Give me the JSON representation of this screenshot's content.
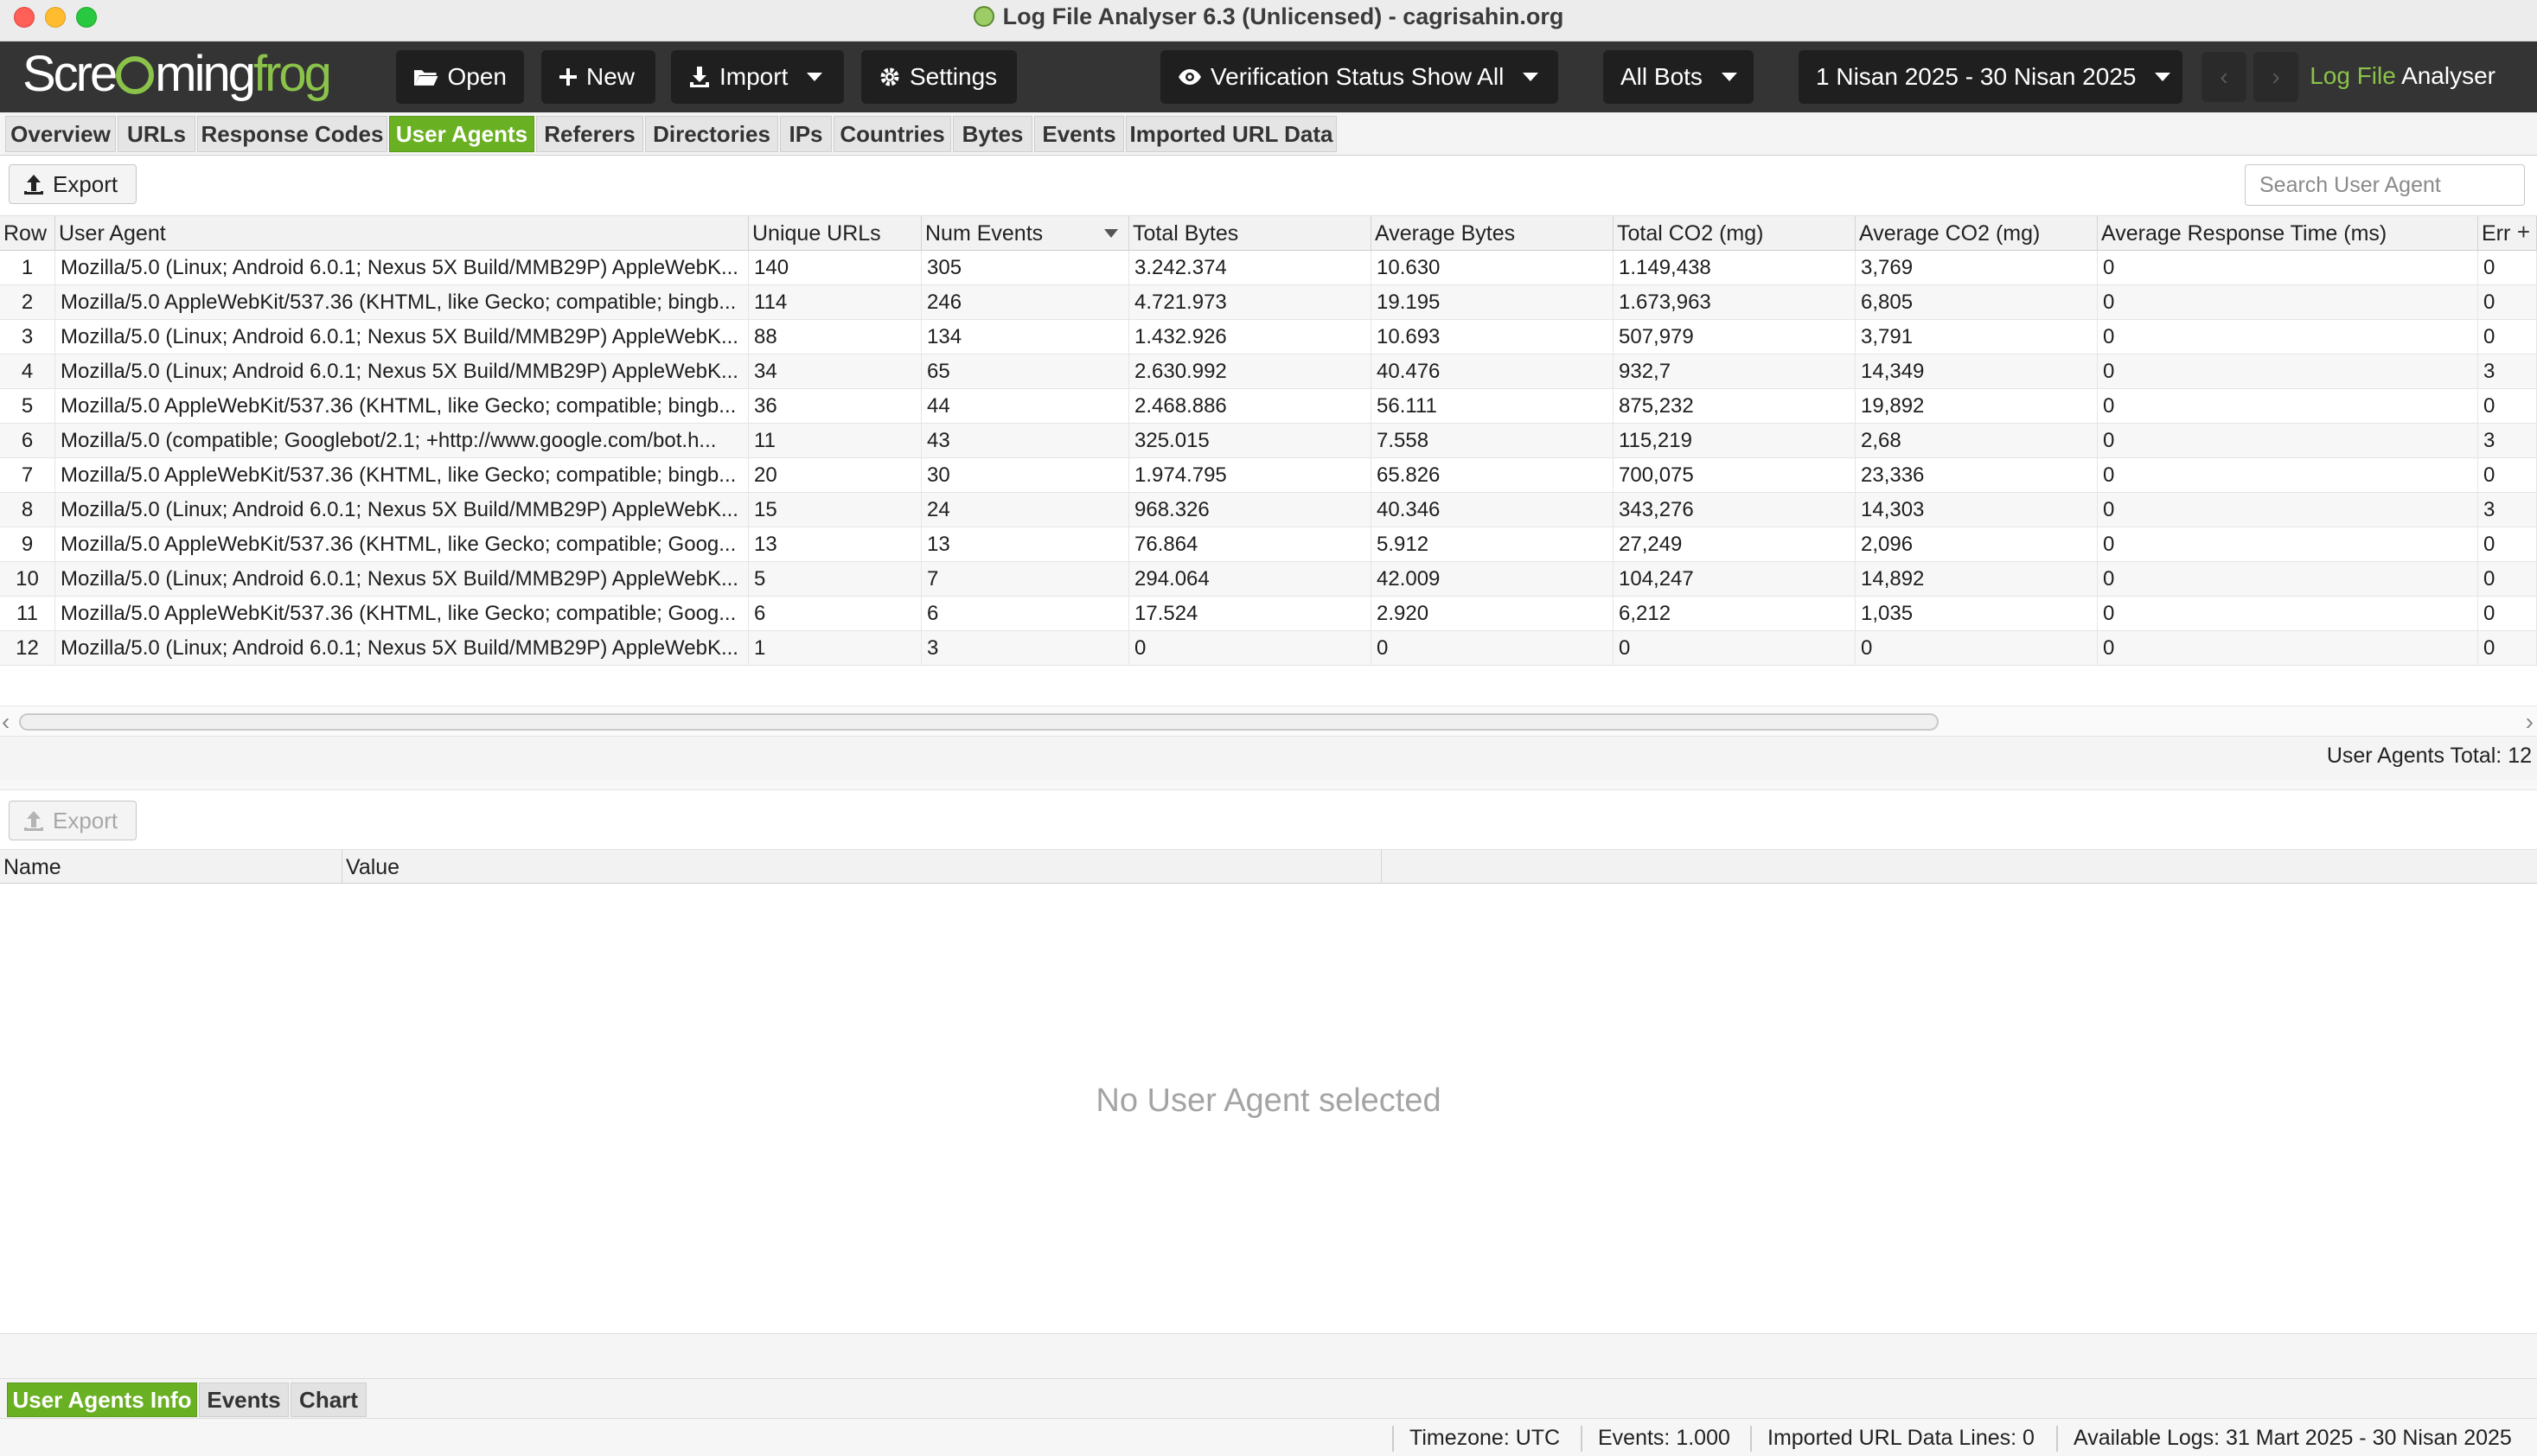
{
  "window": {
    "title": "Log File Analyser 6.3 (Unlicensed) - cagrisahin.org"
  },
  "toolbar": {
    "logo_part1": "Scre",
    "logo_part2": "ming",
    "logo_part3": "frog",
    "open_label": "Open",
    "new_label": "New",
    "import_label": "Import",
    "settings_label": "Settings",
    "verification_label": "Verification Status Show All",
    "bots_label": "All Bots",
    "date_range_label": "1 Nisan 2025 - 30 Nisan 2025",
    "prev_arrow": "‹",
    "next_arrow": "›",
    "brand_green": "Log File",
    "brand_white": "Analyser"
  },
  "tabs": [
    {
      "label": "Overview"
    },
    {
      "label": "URLs"
    },
    {
      "label": "Response Codes"
    },
    {
      "label": "User Agents"
    },
    {
      "label": "Referers"
    },
    {
      "label": "Directories"
    },
    {
      "label": "IPs"
    },
    {
      "label": "Countries"
    },
    {
      "label": "Bytes"
    },
    {
      "label": "Events"
    },
    {
      "label": "Imported URL Data"
    }
  ],
  "active_tab": "User Agents",
  "export_label": "Export",
  "search": {
    "placeholder": "Search User Agent",
    "value": ""
  },
  "table": {
    "columns": [
      "Row",
      "User Agent",
      "Unique URLs",
      "Num Events",
      "Total Bytes",
      "Average Bytes",
      "Total CO2 (mg)",
      "Average CO2 (mg)",
      "Average Response Time (ms)",
      "Err"
    ],
    "sorted_column": "Num Events",
    "add_column_glyph": "+",
    "rows": [
      [
        "1",
        "Mozilla/5.0 (Linux; Android 6.0.1; Nexus 5X Build/MMB29P) AppleWebK...",
        "140",
        "305",
        "3.242.374",
        "10.630",
        "1.149,438",
        "3,769",
        "0",
        "0"
      ],
      [
        "2",
        "Mozilla/5.0 AppleWebKit/537.36 (KHTML, like Gecko; compatible; bingb...",
        "114",
        "246",
        "4.721.973",
        "19.195",
        "1.673,963",
        "6,805",
        "0",
        "0"
      ],
      [
        "3",
        "Mozilla/5.0 (Linux; Android 6.0.1; Nexus 5X Build/MMB29P) AppleWebK...",
        "88",
        "134",
        "1.432.926",
        "10.693",
        "507,979",
        "3,791",
        "0",
        "0"
      ],
      [
        "4",
        "Mozilla/5.0 (Linux; Android 6.0.1; Nexus 5X Build/MMB29P) AppleWebK...",
        "34",
        "65",
        "2.630.992",
        "40.476",
        "932,7",
        "14,349",
        "0",
        "3"
      ],
      [
        "5",
        "Mozilla/5.0 AppleWebKit/537.36 (KHTML, like Gecko; compatible; bingb...",
        "36",
        "44",
        "2.468.886",
        "56.111",
        "875,232",
        "19,892",
        "0",
        "0"
      ],
      [
        "6",
        "Mozilla/5.0 (compatible; Googlebot/2.1; +http://www.google.com/bot.h...",
        "11",
        "43",
        "325.015",
        "7.558",
        "115,219",
        "2,68",
        "0",
        "3"
      ],
      [
        "7",
        "Mozilla/5.0 AppleWebKit/537.36 (KHTML, like Gecko; compatible; bingb...",
        "20",
        "30",
        "1.974.795",
        "65.826",
        "700,075",
        "23,336",
        "0",
        "0"
      ],
      [
        "8",
        "Mozilla/5.0 (Linux; Android 6.0.1; Nexus 5X Build/MMB29P) AppleWebK...",
        "15",
        "24",
        "968.326",
        "40.346",
        "343,276",
        "14,303",
        "0",
        "3"
      ],
      [
        "9",
        "Mozilla/5.0 AppleWebKit/537.36 (KHTML, like Gecko; compatible; Goog...",
        "13",
        "13",
        "76.864",
        "5.912",
        "27,249",
        "2,096",
        "0",
        "0"
      ],
      [
        "10",
        "Mozilla/5.0 (Linux; Android 6.0.1; Nexus 5X Build/MMB29P) AppleWebK...",
        "5",
        "7",
        "294.064",
        "42.009",
        "104,247",
        "14,892",
        "0",
        "0"
      ],
      [
        "11",
        "Mozilla/5.0 AppleWebKit/537.36 (KHTML, like Gecko; compatible; Goog...",
        "6",
        "6",
        "17.524",
        "2.920",
        "6,212",
        "1,035",
        "0",
        "0"
      ],
      [
        "12",
        "Mozilla/5.0 (Linux; Android 6.0.1; Nexus 5X Build/MMB29P) AppleWebK...",
        "1",
        "3",
        "0",
        "0",
        "0",
        "0",
        "0",
        "0"
      ]
    ]
  },
  "scroll": {
    "left_arrow": "‹",
    "right_arrow": "›"
  },
  "totals": {
    "label": "User Agents Total: 12"
  },
  "lower": {
    "export_label": "Export",
    "columns": [
      "Name",
      "Value"
    ],
    "empty_message": "No User Agent selected"
  },
  "bottom_tabs": [
    {
      "label": "User Agents Info"
    },
    {
      "label": "Events"
    },
    {
      "label": "Chart"
    }
  ],
  "active_bottom_tab": "User Agents Info",
  "status": {
    "timezone": "Timezone:  UTC",
    "events": "Events:  1.000",
    "imported_lines": "Imported URL Data Lines:  0",
    "available_logs": "Available Logs:  31 Mart 2025 - 30 Nisan 2025"
  },
  "colors": {
    "accent_green": "#6ab023",
    "toolbar_bg": "#343434",
    "logo_green": "#8bc34a"
  }
}
